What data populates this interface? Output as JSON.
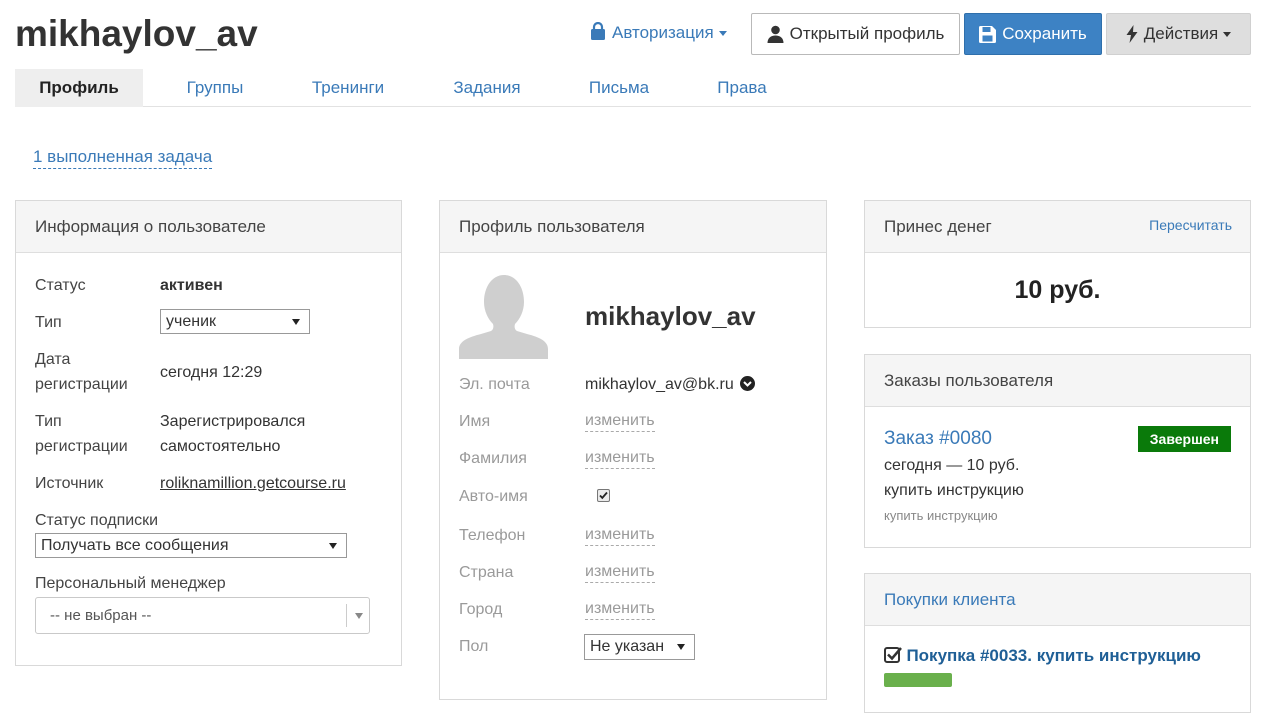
{
  "header": {
    "title": "mikhaylov_av",
    "auth_label": "Авторизация",
    "open_profile_label": "Открытый профиль",
    "save_label": "Сохранить",
    "actions_label": "Действия"
  },
  "tabs": [
    {
      "label": "Профиль",
      "active": true
    },
    {
      "label": "Группы",
      "active": false
    },
    {
      "label": "Тренинги",
      "active": false
    },
    {
      "label": "Задания",
      "active": false
    },
    {
      "label": "Письма",
      "active": false
    },
    {
      "label": "Права",
      "active": false
    }
  ],
  "tasks_link": "1 выполненная задача",
  "user_info": {
    "title": "Информация о пользователе",
    "status_label": "Статус",
    "status_value": "активен",
    "type_label": "Тип",
    "type_value": "ученик",
    "regdate_label_1": "Дата",
    "regdate_label_2": "регистрации",
    "regdate_value": "сегодня 12:29",
    "regtype_label_1": "Тип",
    "regtype_label_2": "регистрации",
    "regtype_value_1": "Зарегистрировался",
    "regtype_value_2": "самостоятельно",
    "source_label": "Источник",
    "source_value": "roliknamillion.getcourse.ru",
    "subscription_label": "Статус подписки",
    "subscription_value": "Получать все сообщения",
    "manager_label": "Персональный менеджер",
    "manager_value": "-- не выбран --"
  },
  "profile": {
    "title": "Профиль пользователя",
    "username": "mikhaylov_av",
    "email_label": "Эл. почта",
    "email_value": "mikhaylov_av@bk.ru",
    "name_label": "Имя",
    "lastname_label": "Фамилия",
    "autoname_label": "Авто-имя",
    "autoname_checked": true,
    "phone_label": "Телефон",
    "country_label": "Страна",
    "city_label": "Город",
    "gender_label": "Пол",
    "gender_value": "Не указан",
    "change_label": "изменить"
  },
  "money": {
    "title": "Принес денег",
    "recalc_label": "Пересчитать",
    "amount": "10 руб."
  },
  "orders": {
    "title": "Заказы пользователя",
    "order_title": "Заказ #0080",
    "order_status": "Завершен",
    "order_line": "сегодня — 10 руб.",
    "order_product": "купить инструкцию",
    "order_product_small": "купить инструкцию"
  },
  "purchases": {
    "title": "Покупки клиента",
    "purchase_title": "Покупка #0033. купить инструкцию"
  },
  "colors": {
    "link": "#3a7ab8",
    "primary": "#3d82c4",
    "success": "#0a7a0a"
  }
}
